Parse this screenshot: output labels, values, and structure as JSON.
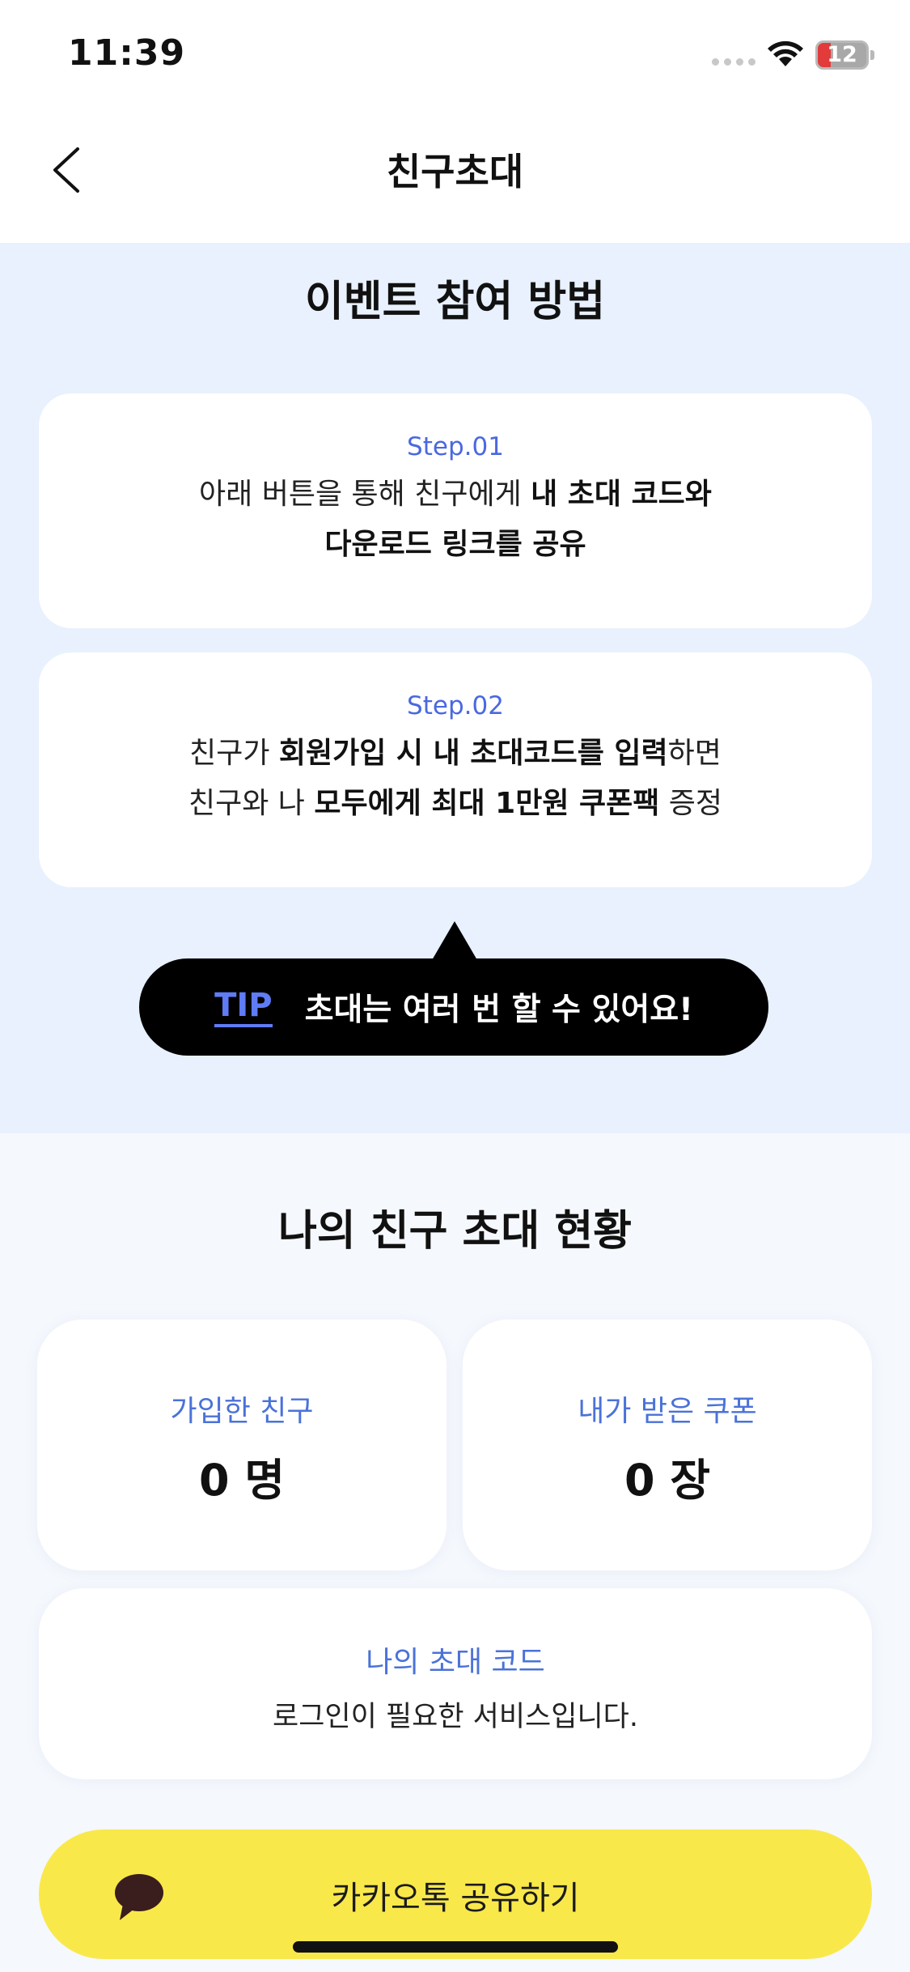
{
  "status_bar": {
    "time": "11:39",
    "battery_level": "12"
  },
  "nav": {
    "title": "친구초대"
  },
  "event": {
    "title": "이벤트 참여 방법",
    "steps": [
      {
        "label": "Step.01",
        "line1": [
          "아래 버튼을 통해 친구에게 ",
          "내 초대 코드와"
        ],
        "line2": [
          "다운로드 링크를 공유"
        ]
      },
      {
        "label": "Step.02",
        "line1": [
          "친구가 ",
          "회원가입 시 내 초대코드를 입력",
          "하면"
        ],
        "line2": [
          "친구와 나 ",
          "모두에게 최대 1만원 쿠폰팩",
          " 증정"
        ]
      }
    ],
    "tip": {
      "tag": "TIP",
      "text": "초대는 여러 번 할 수 있어요!"
    }
  },
  "invite_status": {
    "title": "나의 친구 초대 현황",
    "joined_friends": {
      "label": "가입한 친구",
      "value": "0 명"
    },
    "received_coupons": {
      "label": "내가 받은 쿠폰",
      "value": "0 장"
    },
    "invite_code": {
      "label": "나의 초대 코드",
      "value": "로그인이 필요한 서비스입니다."
    },
    "share_button": {
      "label": "카카오톡 공유하기"
    }
  },
  "colors": {
    "accent": "#4a68e0",
    "kakao_yellow": "#f9e84a",
    "section_bg": "#e8f1fd"
  }
}
